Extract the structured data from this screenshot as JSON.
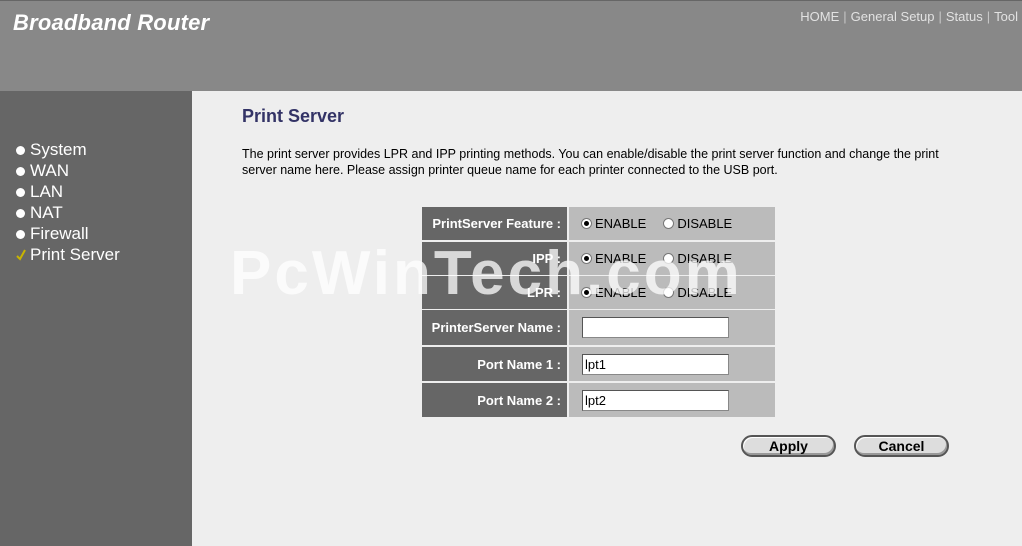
{
  "header": {
    "brand": "Broadband Router",
    "nav": [
      "HOME",
      "General Setup",
      "Status",
      "Tool"
    ]
  },
  "sidebar": {
    "items": [
      {
        "label": "System",
        "active": false
      },
      {
        "label": "WAN",
        "active": false
      },
      {
        "label": "LAN",
        "active": false
      },
      {
        "label": "NAT",
        "active": false
      },
      {
        "label": "Firewall",
        "active": false
      },
      {
        "label": "Print Server",
        "active": true
      }
    ]
  },
  "main": {
    "title": "Print Server",
    "description": "The print server provides LPR and IPP printing methods. You can enable/disable the print server function and change the print server name here. Please assign printer queue name for each printer connected to the USB port.",
    "watermark": "PcWinTech.com",
    "rows": [
      {
        "label": "PrintServer Feature :",
        "type": "radio",
        "options": [
          "ENABLE",
          "DISABLE"
        ],
        "selected": "ENABLE"
      },
      {
        "label": "IPP :",
        "type": "radio",
        "options": [
          "ENABLE",
          "DISABLE"
        ],
        "selected": "ENABLE"
      },
      {
        "label": "LPR :",
        "type": "radio",
        "options": [
          "ENABLE",
          "DISABLE"
        ],
        "selected": "ENABLE"
      },
      {
        "label": "PrinterServer Name :",
        "type": "text",
        "value": ""
      },
      {
        "label": "Port Name 1 :",
        "type": "text",
        "value": "lpt1"
      },
      {
        "label": "Port Name 2 :",
        "type": "text",
        "value": "lpt2"
      }
    ],
    "buttons": {
      "apply": "Apply",
      "cancel": "Cancel"
    }
  },
  "colors": {
    "header_bg": "#888888",
    "sidebar_bg": "#666666",
    "label_bg": "#666666",
    "value_bg": "#bbbbbb",
    "title_color": "#333366",
    "check_color": "#c8b400"
  }
}
